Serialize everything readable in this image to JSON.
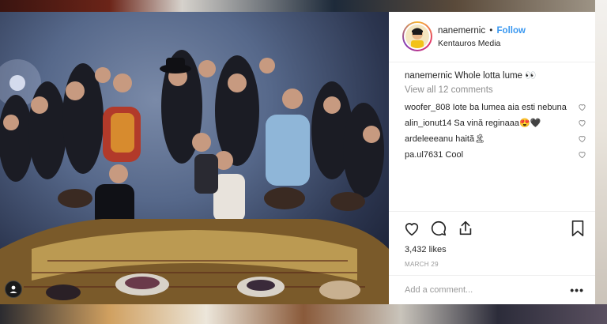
{
  "post": {
    "username": "nanemernic",
    "separator": "•",
    "follow_label": "Follow",
    "location": "Kentauros Media",
    "caption_user": "nanemernic",
    "caption_text": "Whole lotta lume 👀",
    "view_all_prefix": "View all",
    "view_all_count": "12 comments",
    "comments": [
      {
        "user": "woofer_808",
        "text": "Iote ba lumea aia esti nebuna"
      },
      {
        "user": "alin_ionut14",
        "text": "Sa vină reginaaa😍🖤"
      },
      {
        "user": "ardeleeeanu",
        "text": "haită🏝"
      },
      {
        "user": "pa.ul7631",
        "text": "Cool"
      }
    ],
    "likes": "3,432 likes",
    "date": "MARCH 29",
    "add_comment_placeholder": "Add a comment...",
    "more_label": "•••"
  },
  "icons": {
    "like": "heart-icon",
    "comment": "comment-icon",
    "share": "share-icon",
    "save": "bookmark-icon",
    "comment_like": "heart-icon",
    "photo_tag": "user-icon"
  },
  "colors": {
    "accent": "#3897f0",
    "text": "#262626",
    "muted": "#8e8e8e",
    "divider": "#efefef"
  }
}
